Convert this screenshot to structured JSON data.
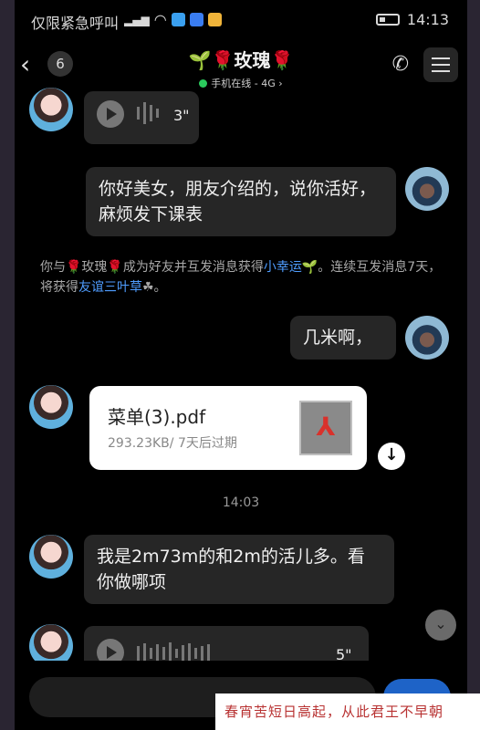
{
  "status_bar": {
    "carrier": "仅限紧急呼叫",
    "time": "14:13"
  },
  "header": {
    "back_icon": "chevron-left",
    "unread_count": "6",
    "title": "🌱🌹玫瑰🌹",
    "subtitle": "手机在线 - 4G",
    "online_color": "#2bcb5d"
  },
  "messages": {
    "voice_1": {
      "duration": "3\""
    },
    "msg_1": {
      "text": "你好美女，朋友介绍的，说你活好，麻烦发下课表"
    },
    "system": {
      "part1": "你与🌹玫瑰🌹成为好友并互发消息获得",
      "link1": "小幸运",
      "part2": "🌱。连续互发消息7天，将获得",
      "link2": "友谊三叶草",
      "part3": "☘。"
    },
    "msg_2": {
      "text": "几米啊，"
    },
    "file": {
      "name": "菜单(3).pdf",
      "meta": "293.23KB/ 7天后过期",
      "icon": "pdf-icon"
    },
    "timestamp": "14:03",
    "msg_3": {
      "text": "我是2m73m的和2m的活儿多。看你做哪项"
    },
    "voice_2": {
      "duration": "5\""
    }
  },
  "watermark": "春宵苦短日高起，从此君王不早朝"
}
